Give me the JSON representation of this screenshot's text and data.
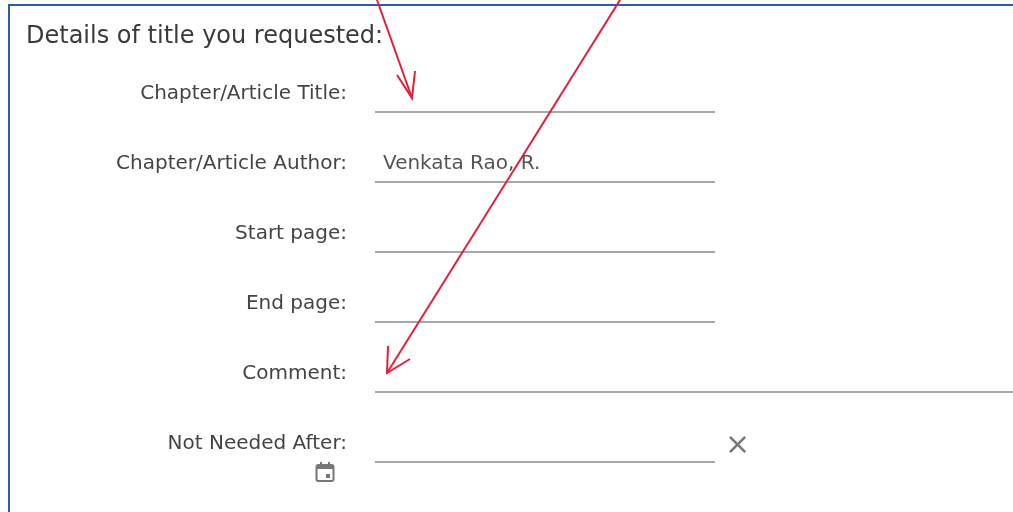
{
  "heading": "Details of title you requested:",
  "fields": [
    {
      "kind": "text",
      "label": "Chapter/Article Title:"
    },
    {
      "kind": "text",
      "label": "Chapter/Article Author:",
      "value": "Venkata Rao, R."
    },
    {
      "kind": "text",
      "label": "Start page:"
    },
    {
      "kind": "text",
      "label": "End page:"
    },
    {
      "kind": "comment",
      "label": "Comment:"
    },
    {
      "kind": "date",
      "label": "Not Needed After:",
      "clear": "×"
    }
  ]
}
